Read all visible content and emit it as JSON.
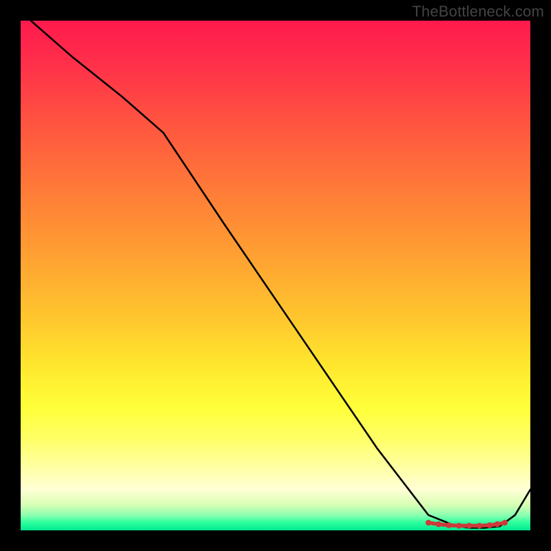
{
  "attribution": "TheBottleneck.com",
  "chart_data": {
    "type": "line",
    "title": "",
    "xlabel": "",
    "ylabel": "",
    "xlim": [
      0,
      100
    ],
    "ylim": [
      0,
      100
    ],
    "series": [
      {
        "name": "curve",
        "x": [
          2,
          10,
          20,
          28,
          40,
          55,
          70,
          80,
          85,
          88,
          91,
          94,
          97,
          100
        ],
        "y": [
          100,
          93,
          85,
          78,
          60,
          38,
          16,
          3,
          1,
          0.5,
          0.5,
          0.8,
          3,
          8
        ]
      }
    ],
    "markers": {
      "name": "segment-highlight",
      "color": "#cc3a3a",
      "x": [
        80,
        82,
        84,
        86,
        88,
        90,
        92,
        93.5,
        95
      ],
      "y": [
        1.5,
        1.2,
        1.0,
        0.9,
        0.9,
        0.9,
        1.0,
        1.2,
        1.5
      ]
    },
    "gradient_stops": [
      {
        "pos": 0.0,
        "color": "#ff1a4d"
      },
      {
        "pos": 0.5,
        "color": "#ffc52e"
      },
      {
        "pos": 0.8,
        "color": "#ffff3a"
      },
      {
        "pos": 0.95,
        "color": "#d8ffb4"
      },
      {
        "pos": 1.0,
        "color": "#00e890"
      }
    ]
  }
}
